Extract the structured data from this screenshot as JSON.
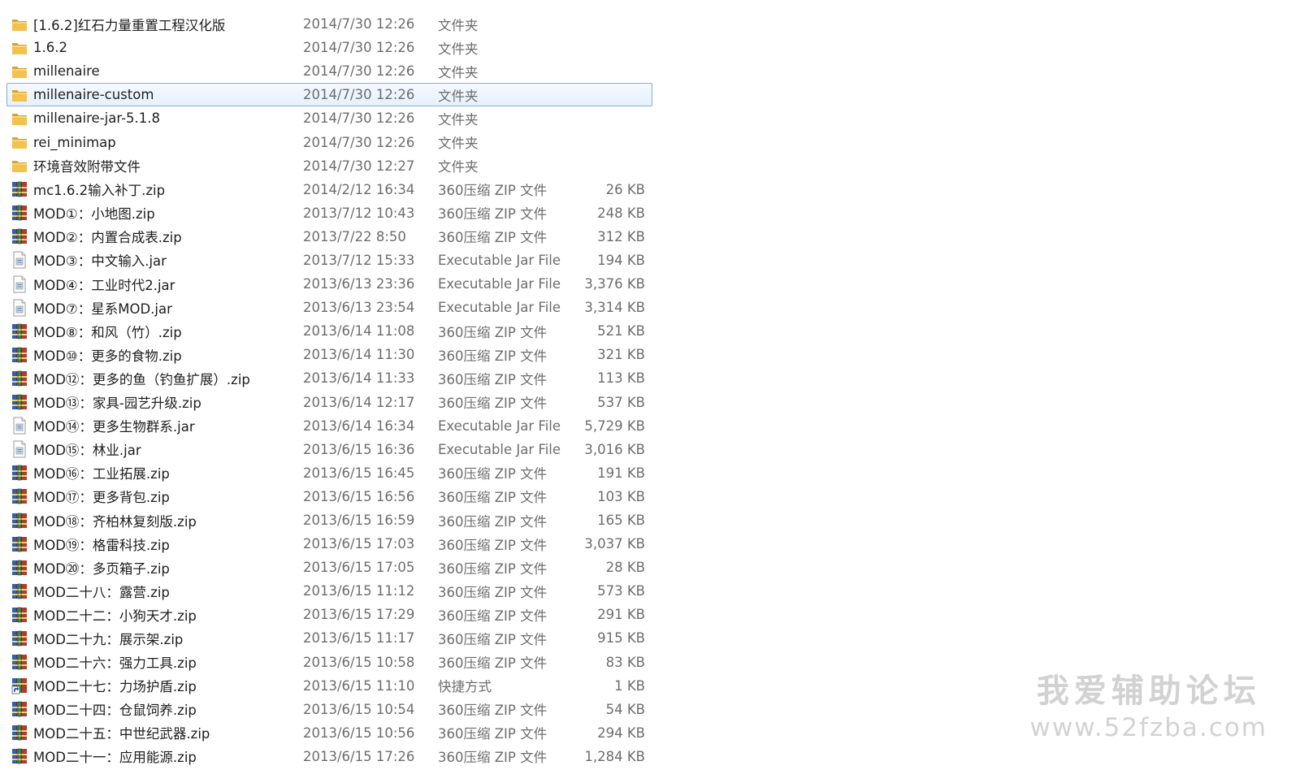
{
  "colors": {
    "folder": "#f2c14e",
    "folder_dark": "#d9a22e",
    "selection_border": "#84acdd",
    "watermark": "#d2d2d2"
  },
  "files": [
    {
      "name": "[1.6.2]红石力量重置工程汉化版",
      "date": "2014/7/30 12:26",
      "type": "文件夹",
      "size": "",
      "icon": "folder-icon"
    },
    {
      "name": "1.6.2",
      "date": "2014/7/30 12:26",
      "type": "文件夹",
      "size": "",
      "icon": "folder-icon"
    },
    {
      "name": "millenaire",
      "date": "2014/7/30 12:26",
      "type": "文件夹",
      "size": "",
      "icon": "folder-icon"
    },
    {
      "name": "millenaire-custom",
      "date": "2014/7/30 12:26",
      "type": "文件夹",
      "size": "",
      "icon": "folder-icon",
      "selected": true
    },
    {
      "name": "millenaire-jar-5.1.8",
      "date": "2014/7/30 12:26",
      "type": "文件夹",
      "size": "",
      "icon": "folder-icon"
    },
    {
      "name": "rei_minimap",
      "date": "2014/7/30 12:26",
      "type": "文件夹",
      "size": "",
      "icon": "folder-icon"
    },
    {
      "name": "环境音效附带文件",
      "date": "2014/7/30 12:27",
      "type": "文件夹",
      "size": "",
      "icon": "folder-icon"
    },
    {
      "name": "mc1.6.2输入补丁.zip",
      "date": "2014/2/12 16:34",
      "type": "360压缩 ZIP 文件",
      "size": "26 KB",
      "icon": "zip-icon"
    },
    {
      "name": "MOD①：小地图.zip",
      "date": "2013/7/12 10:43",
      "type": "360压缩 ZIP 文件",
      "size": "248 KB",
      "icon": "zip-icon"
    },
    {
      "name": "MOD②：内置合成表.zip",
      "date": "2013/7/22 8:50",
      "type": "360压缩 ZIP 文件",
      "size": "312 KB",
      "icon": "zip-icon"
    },
    {
      "name": "MOD③：中文输入.jar",
      "date": "2013/7/12 15:33",
      "type": "Executable Jar File",
      "size": "194 KB",
      "icon": "jar-icon"
    },
    {
      "name": "MOD④：工业时代2.jar",
      "date": "2013/6/13 23:36",
      "type": "Executable Jar File",
      "size": "3,376 KB",
      "icon": "jar-icon"
    },
    {
      "name": "MOD⑦：星系MOD.jar",
      "date": "2013/6/13 23:54",
      "type": "Executable Jar File",
      "size": "3,314 KB",
      "icon": "jar-icon"
    },
    {
      "name": "MOD⑧：和风（竹）.zip",
      "date": "2013/6/14 11:08",
      "type": "360压缩 ZIP 文件",
      "size": "521 KB",
      "icon": "zip-icon"
    },
    {
      "name": "MOD⑩：更多的食物.zip",
      "date": "2013/6/14 11:30",
      "type": "360压缩 ZIP 文件",
      "size": "321 KB",
      "icon": "zip-icon"
    },
    {
      "name": "MOD⑫：更多的鱼（钓鱼扩展）.zip",
      "date": "2013/6/14 11:33",
      "type": "360压缩 ZIP 文件",
      "size": "113 KB",
      "icon": "zip-icon"
    },
    {
      "name": "MOD⑬：家具-园艺升级.zip",
      "date": "2013/6/14 12:17",
      "type": "360压缩 ZIP 文件",
      "size": "537 KB",
      "icon": "zip-icon"
    },
    {
      "name": "MOD⑭：更多生物群系.jar",
      "date": "2013/6/14 16:34",
      "type": "Executable Jar File",
      "size": "5,729 KB",
      "icon": "jar-icon"
    },
    {
      "name": "MOD⑮：林业.jar",
      "date": "2013/6/15 16:36",
      "type": "Executable Jar File",
      "size": "3,016 KB",
      "icon": "jar-icon"
    },
    {
      "name": "MOD⑯：工业拓展.zip",
      "date": "2013/6/15 16:45",
      "type": "360压缩 ZIP 文件",
      "size": "191 KB",
      "icon": "zip-icon"
    },
    {
      "name": "MOD⑰：更多背包.zip",
      "date": "2013/6/15 16:56",
      "type": "360压缩 ZIP 文件",
      "size": "103 KB",
      "icon": "zip-icon"
    },
    {
      "name": "MOD⑱：齐柏林复刻版.zip",
      "date": "2013/6/15 16:59",
      "type": "360压缩 ZIP 文件",
      "size": "165 KB",
      "icon": "zip-icon"
    },
    {
      "name": "MOD⑲：格雷科技.zip",
      "date": "2013/6/15 17:03",
      "type": "360压缩 ZIP 文件",
      "size": "3,037 KB",
      "icon": "zip-icon"
    },
    {
      "name": "MOD⑳：多页箱子.zip",
      "date": "2013/6/15 17:05",
      "type": "360压缩 ZIP 文件",
      "size": "28 KB",
      "icon": "zip-icon"
    },
    {
      "name": "MOD二十八：露营.zip",
      "date": "2013/6/15 11:12",
      "type": "360压缩 ZIP 文件",
      "size": "573 KB",
      "icon": "zip-icon"
    },
    {
      "name": "MOD二十二：小狗天才.zip",
      "date": "2013/6/15 17:29",
      "type": "360压缩 ZIP 文件",
      "size": "291 KB",
      "icon": "zip-icon"
    },
    {
      "name": "MOD二十九：展示架.zip",
      "date": "2013/6/15 11:17",
      "type": "360压缩 ZIP 文件",
      "size": "915 KB",
      "icon": "zip-icon"
    },
    {
      "name": "MOD二十六：强力工具.zip",
      "date": "2013/6/15 10:58",
      "type": "360压缩 ZIP 文件",
      "size": "83 KB",
      "icon": "zip-icon"
    },
    {
      "name": "MOD二十七：力场护盾.zip",
      "date": "2013/6/15 11:10",
      "type": "快捷方式",
      "size": "1 KB",
      "icon": "shortcut-icon"
    },
    {
      "name": "MOD二十四：仓鼠饲养.zip",
      "date": "2013/6/15 10:54",
      "type": "360压缩 ZIP 文件",
      "size": "54 KB",
      "icon": "zip-icon"
    },
    {
      "name": "MOD二十五：中世纪武器.zip",
      "date": "2013/6/15 10:56",
      "type": "360压缩 ZIP 文件",
      "size": "294 KB",
      "icon": "zip-icon"
    },
    {
      "name": "MOD二十一：应用能源.zip",
      "date": "2013/6/15 17:26",
      "type": "360压缩 ZIP 文件",
      "size": "1,284 KB",
      "icon": "zip-icon"
    }
  ],
  "watermark": {
    "title": "我爱辅助论坛",
    "url": "www.52fzba.com"
  }
}
